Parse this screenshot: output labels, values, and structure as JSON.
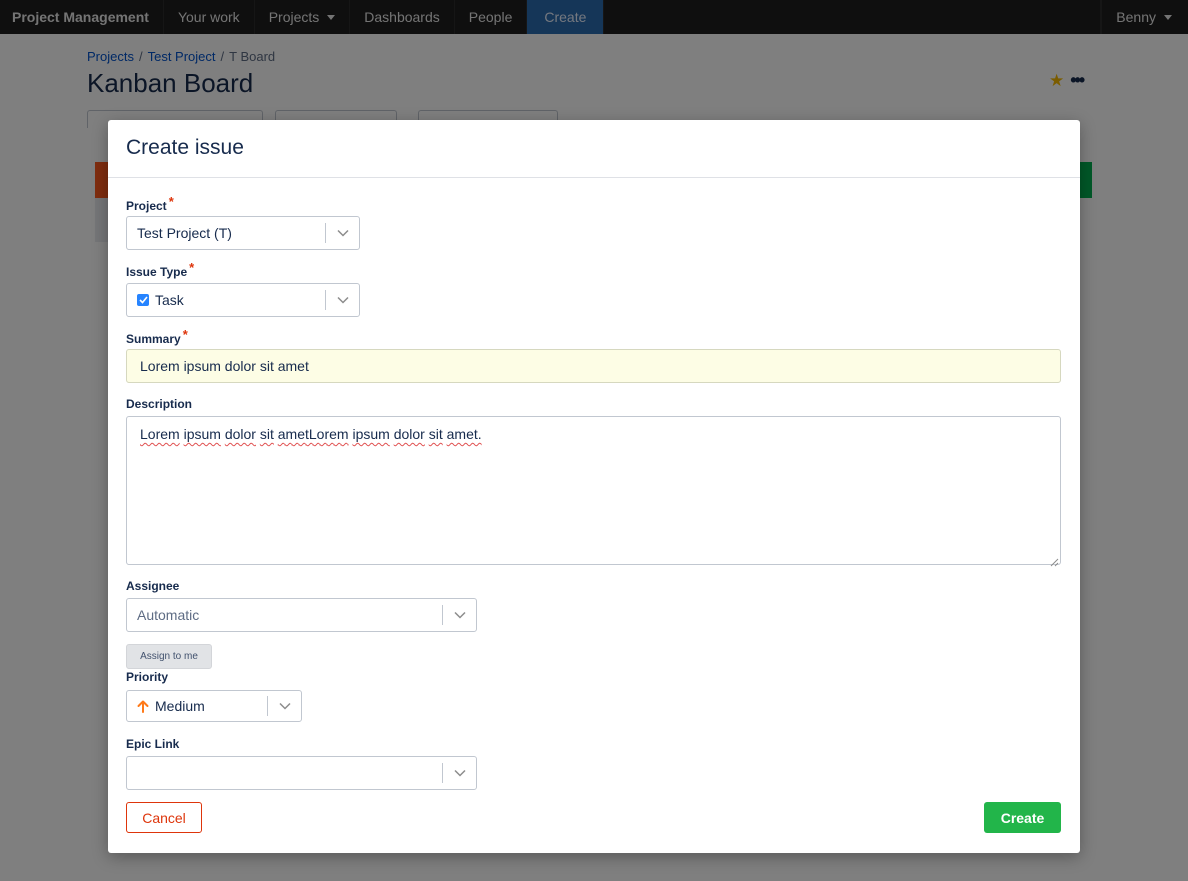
{
  "app": {
    "brand": "Project Management",
    "nav": [
      "Your work",
      "Projects",
      "Dashboards",
      "People"
    ],
    "create_label": "Create",
    "user": "Benny"
  },
  "page": {
    "breadcrumb": [
      "Projects",
      "Test Project",
      "T Board"
    ],
    "breadcrumb_separator": "/",
    "title": "Kanban Board",
    "more_label": "•••"
  },
  "modal": {
    "title": "Create issue",
    "project": {
      "label": "Project",
      "value": "Test Project (T)"
    },
    "issue_type": {
      "label": "Issue Type",
      "value": "Task",
      "icon": "task-checkbox-icon"
    },
    "summary": {
      "label": "Summary",
      "value": "Lorem ipsum dolor sit amet"
    },
    "description": {
      "label": "Description",
      "words": [
        "Lorem",
        "ipsum",
        "dolor",
        "sit",
        "ametLorem",
        "ipsum",
        "dolor",
        "sit",
        "amet."
      ]
    },
    "assignee": {
      "label": "Assignee",
      "value": "Automatic",
      "assign_to_me": "Assign to me"
    },
    "priority": {
      "label": "Priority",
      "value": "Medium",
      "icon": "arrow-up-icon",
      "icon_color": "#ff7a1a"
    },
    "epic_link": {
      "label": "Epic Link",
      "value": ""
    },
    "required_marker": "*",
    "cancel_label": "Cancel",
    "create_label": "Create"
  },
  "colors": {
    "accent": "#2684ff",
    "create_button": "#22b54a",
    "cancel_button": "#de350b",
    "summary_background": "#fdfde5"
  }
}
